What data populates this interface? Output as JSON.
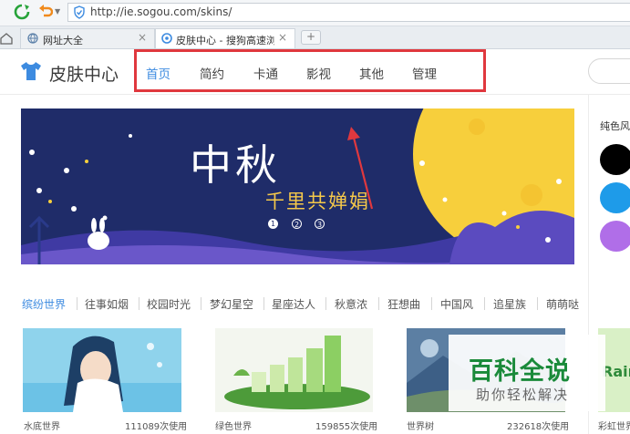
{
  "browser": {
    "url": "http://ie.sogou.com/skins/",
    "tabs": [
      {
        "label": "网址大全",
        "close": "×"
      },
      {
        "label": "皮肤中心 - 搜狗高速浏览",
        "close": "×"
      }
    ],
    "new_tab_label": "+"
  },
  "site": {
    "title": "皮肤中心",
    "nav": [
      "首页",
      "简约",
      "卡通",
      "影视",
      "其他",
      "管理"
    ],
    "active_nav": "首页",
    "accent_color": "#3d8be0",
    "highlight_color": "#e0383e"
  },
  "banner": {
    "title": "中秋",
    "subtitle": "千里共婵娟",
    "dots": [
      "1",
      "2",
      "3"
    ],
    "active_dot": "1"
  },
  "side_panel": {
    "title": "纯色风",
    "swatches": [
      "#000000",
      "#1e9be9",
      "#b06ee8"
    ]
  },
  "categories": [
    "缤纷世界",
    "往事如烟",
    "校园时光",
    "梦幻星空",
    "星座达人",
    "秋意浓",
    "狂想曲",
    "中国风",
    "追星族",
    "萌萌哒"
  ],
  "cards": [
    {
      "name": "水底世界",
      "uses": "111089次使用"
    },
    {
      "name": "绿色世界",
      "uses": "159855次使用"
    },
    {
      "name": "世界树",
      "uses": "232618次使用"
    },
    {
      "name": "彩虹世界",
      "uses": ""
    }
  ],
  "watermark": {
    "title": "百科全说",
    "subtitle": "助你轻松解决"
  },
  "partial_card_text": "Rair"
}
